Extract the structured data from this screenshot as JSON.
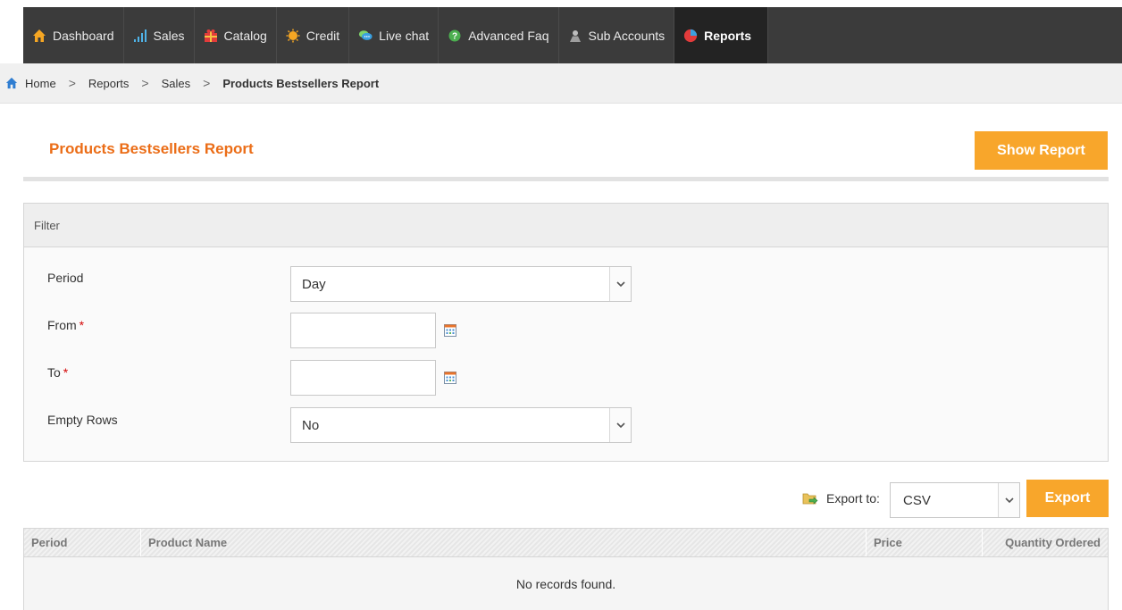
{
  "nav": {
    "items": [
      {
        "label": "Dashboard",
        "icon": "home-icon",
        "color": "#f5a623"
      },
      {
        "label": "Sales",
        "icon": "bar-chart-icon",
        "color": "#4fb3e8"
      },
      {
        "label": "Catalog",
        "icon": "gift-icon",
        "color": "#e23b3b"
      },
      {
        "label": "Credit",
        "icon": "coin-icon",
        "color": "#f5a623"
      },
      {
        "label": "Live chat",
        "icon": "chat-bubbles-icon",
        "color": "#3aa0e0"
      },
      {
        "label": "Advanced Faq",
        "icon": "question-icon",
        "color": "#4caf50"
      },
      {
        "label": "Sub Accounts",
        "icon": "user-icon",
        "color": "#bdbdbd"
      },
      {
        "label": "Reports",
        "icon": "pie-chart-icon",
        "color": "#e23b3b"
      }
    ],
    "active": "Reports"
  },
  "breadcrumb": {
    "items": [
      "Home",
      "Reports",
      "Sales"
    ],
    "current": "Products Bestsellers Report",
    "separator": ">"
  },
  "page": {
    "title": "Products Bestsellers Report",
    "show_report_label": "Show Report"
  },
  "filter": {
    "heading": "Filter",
    "period_label": "Period",
    "period_value": "Day",
    "from_label": "From",
    "to_label": "To",
    "required_mark": "*",
    "empty_rows_label": "Empty Rows",
    "empty_rows_value": "No"
  },
  "export": {
    "label": "Export to:",
    "format": "CSV",
    "button_label": "Export"
  },
  "grid": {
    "columns": [
      "Period",
      "Product Name",
      "Price",
      "Quantity Ordered"
    ],
    "empty_message": "No records found."
  },
  "colors": {
    "accent": "#f8a62b",
    "title": "#eb6d17",
    "nav_bg": "#3b3b3b"
  }
}
